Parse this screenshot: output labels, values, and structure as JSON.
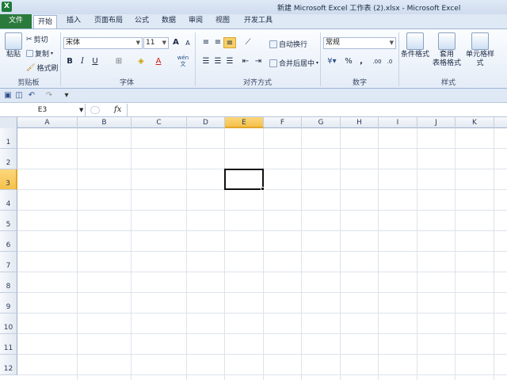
{
  "window": {
    "title": "新建 Microsoft Excel 工作表 (2).xlsx - Microsoft Excel",
    "app_icon": "X"
  },
  "tabs": [
    "文件",
    "开始",
    "插入",
    "页面布局",
    "公式",
    "数据",
    "审阅",
    "视图",
    "开发工具"
  ],
  "ribbon": {
    "clipboard": {
      "label": "剪贴板",
      "paste": "粘贴",
      "cut": "剪切",
      "copy": "复制",
      "format_painter": "格式刷"
    },
    "font": {
      "label": "字体",
      "name": "宋体",
      "size": "11",
      "bold": "B",
      "italic": "I",
      "underline": "U",
      "grow": "A",
      "shrink": "A",
      "font_color": "A",
      "wen": "wén 文"
    },
    "alignment": {
      "label": "对齐方式",
      "wrap": "自动换行",
      "merge": "合并后居中"
    },
    "number": {
      "label": "数字",
      "format": "常规",
      "percent": "%",
      "comma": ","
    },
    "styles": {
      "label": "样式",
      "conditional": "条件格式",
      "table_line1": "套用",
      "table_line2": "表格格式",
      "cell_styles": "单元格样式"
    }
  },
  "formula_bar": {
    "name_box": "E3",
    "fx": "fx",
    "content": ""
  },
  "columns": [
    "A",
    "B",
    "C",
    "D",
    "E",
    "F",
    "G",
    "H",
    "I",
    "J",
    "K"
  ],
  "rows": [
    "1",
    "2",
    "3",
    "4",
    "5",
    "6",
    "7",
    "8",
    "9",
    "10",
    "11",
    "12"
  ],
  "selected": {
    "column": "E",
    "row": "3"
  }
}
